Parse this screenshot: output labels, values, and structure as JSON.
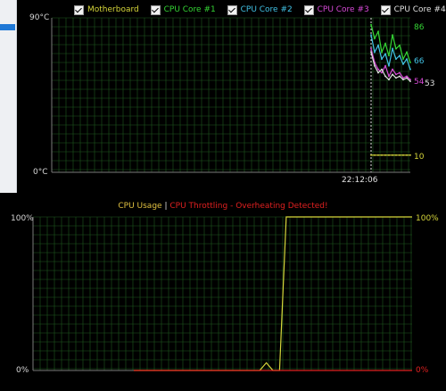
{
  "sidebar": {},
  "temperature_panel": {
    "legend": [
      {
        "label": "Motherboard",
        "color": "#d6d63a",
        "checked": true
      },
      {
        "label": "CPU Core #1",
        "color": "#35d635",
        "checked": true
      },
      {
        "label": "CPU Core #2",
        "color": "#42c3e6",
        "checked": true
      },
      {
        "label": "CPU Core #3",
        "color": "#d84ad8",
        "checked": true
      },
      {
        "label": "CPU Core #4",
        "color": "#e0e0e0",
        "checked": true
      }
    ],
    "y_max_label": "90°C",
    "y_min_label": "0°C",
    "time_label": "22:12:06",
    "value_labels": {
      "core1": "86",
      "core2": "66",
      "core3": "54",
      "core4": "53",
      "motherboard": "10"
    }
  },
  "usage_panel": {
    "title_usage": "CPU Usage",
    "separator": "|",
    "title_throttle": "CPU Throttling - Overheating Detected!",
    "y_max_left": "100%",
    "y_min_left": "0%",
    "y_max_right": "100%",
    "y_min_right": "0%"
  },
  "colors": {
    "grid": "#1f5a1f",
    "axis": "#7a7a7a",
    "motherboard": "#d6d63a",
    "core1": "#35d635",
    "core2": "#42c3e6",
    "core3": "#d84ad8",
    "core4": "#e0e0e0",
    "usage": "#d6d63a",
    "throttle": "#e02020",
    "usage_label": "#e0c040",
    "throttle_label": "#e02020"
  },
  "chart_data": [
    {
      "type": "line",
      "title": "",
      "ylim": [
        0,
        90
      ],
      "series": [
        {
          "name": "Motherboard",
          "values": [
            10,
            10,
            10,
            10,
            10,
            10,
            10,
            10,
            10,
            10,
            10,
            10
          ]
        },
        {
          "name": "CPU Core #1",
          "values": [
            86,
            78,
            82,
            70,
            75,
            68,
            80,
            72,
            74,
            66,
            70,
            64
          ]
        },
        {
          "name": "CPU Core #2",
          "values": [
            80,
            70,
            74,
            66,
            69,
            62,
            72,
            66,
            68,
            63,
            66,
            60
          ]
        },
        {
          "name": "CPU Core #3",
          "values": [
            72,
            64,
            60,
            58,
            62,
            56,
            60,
            57,
            58,
            55,
            56,
            54
          ]
        },
        {
          "name": "CPU Core #4",
          "values": [
            70,
            62,
            58,
            60,
            56,
            54,
            57,
            55,
            56,
            54,
            55,
            53
          ]
        }
      ]
    },
    {
      "type": "line",
      "title": "",
      "ylim": [
        0,
        100
      ],
      "series": [
        {
          "name": "CPU Usage",
          "values": [
            0,
            0,
            0,
            0,
            0,
            0,
            0,
            0,
            0,
            0,
            0,
            0,
            0,
            0,
            0,
            0,
            0,
            0,
            0,
            0,
            5,
            0,
            0,
            100,
            100,
            100,
            100,
            100,
            100,
            100,
            100,
            100,
            100,
            100,
            100,
            100,
            100,
            100,
            100,
            100,
            100,
            100,
            100
          ]
        },
        {
          "name": "CPU Throttling",
          "values": [
            0,
            0,
            0,
            0,
            0,
            0,
            0,
            0,
            0,
            0,
            0,
            0,
            0,
            0,
            0,
            0,
            0,
            0,
            0,
            0,
            0,
            0,
            0,
            0,
            0,
            0,
            0,
            0,
            0,
            0,
            0,
            0,
            0,
            0,
            0,
            0,
            0,
            0,
            0,
            0,
            0,
            0,
            0
          ]
        }
      ]
    }
  ]
}
